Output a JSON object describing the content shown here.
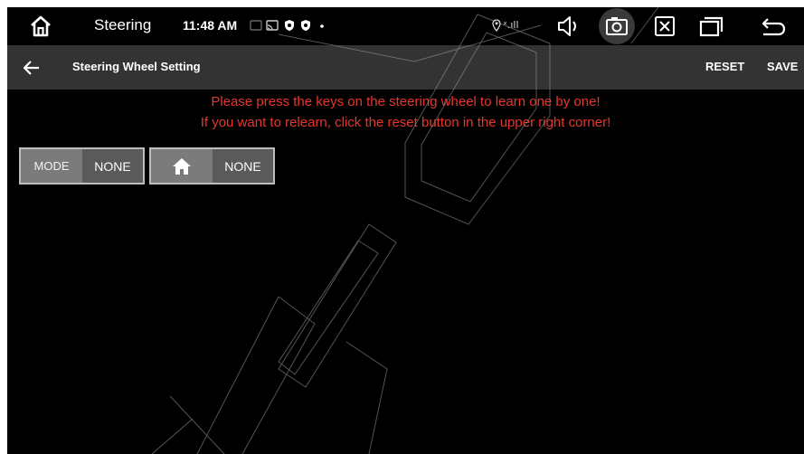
{
  "status_bar": {
    "app_title": "Steering",
    "time": "11:48 AM",
    "signal_text": "ˣ.ıll",
    "notification_icons": [
      "cast-icon",
      "screen-mirror-icon",
      "shield-icon",
      "shield-icon",
      "dot-icon"
    ],
    "right_icons": [
      "location-icon",
      "signal-icon",
      "volume-icon",
      "camera-icon",
      "close-box-icon",
      "recents-icon",
      "back-icon"
    ]
  },
  "title_bar": {
    "title": "Steering Wheel Setting",
    "reset_label": "RESET",
    "save_label": "SAVE"
  },
  "messages": {
    "line1": "Please press the keys on the steering wheel to learn one by one!",
    "line2": "If you want to relearn, click the reset button in the upper right corner!"
  },
  "keys": [
    {
      "key_label": "MODE",
      "assigned": "NONE"
    },
    {
      "key_icon": "home-icon",
      "assigned": "NONE"
    }
  ],
  "colors": {
    "background": "#000000",
    "title_bar": "#333333",
    "message_text": "#e8352e",
    "key_left_bg": "#7b7b7b",
    "key_right_bg": "#5a5a5a"
  }
}
